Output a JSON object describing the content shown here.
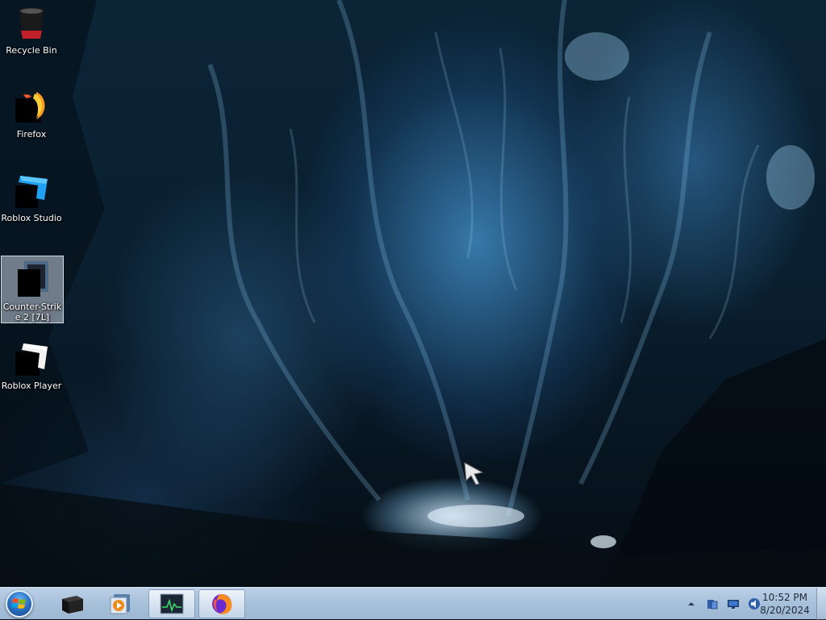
{
  "desktop": {
    "icons": [
      {
        "label": "Recycle Bin",
        "icon": "recycle-bin-icon"
      },
      {
        "label": "Firefox",
        "icon": "firefox-icon"
      },
      {
        "label": "Roblox Studio",
        "icon": "roblox-studio-icon"
      },
      {
        "label": "Counter-Strike 2 [7L]",
        "icon": "counter-strike-icon",
        "selected": true
      },
      {
        "label": "Roblox Player",
        "icon": "roblox-player-icon"
      }
    ]
  },
  "taskbar": {
    "start_icon": "windows-logo-icon",
    "pinned": [
      {
        "icon": "black-box-icon"
      },
      {
        "icon": "media-player-icon"
      },
      {
        "icon": "task-manager-icon",
        "state": "active"
      },
      {
        "icon": "firefox-icon",
        "state": "active"
      }
    ],
    "tray": {
      "icons": [
        "chevron-up-icon",
        "network-device-icon",
        "monitor-icon",
        "volume-icon"
      ],
      "time": "10:52 PM",
      "date": "8/20/2024"
    }
  },
  "colors": {
    "taskbar": "#a9c2dc",
    "wallpaper_dark": "#07141f",
    "wallpaper_ice": "#4b9ad4"
  }
}
